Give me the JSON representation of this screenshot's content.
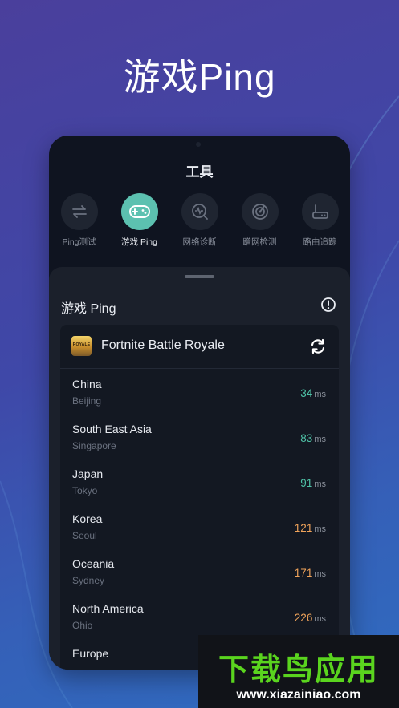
{
  "hero_title": "游戏Ping",
  "tools": {
    "title": "工具",
    "items": [
      {
        "label": "Ping测试",
        "icon": "arrows-swap-icon",
        "active": false
      },
      {
        "label": "游戏 Ping",
        "icon": "gamepad-icon",
        "active": true
      },
      {
        "label": "网络诊断",
        "icon": "network-diagnosis-icon",
        "active": false
      },
      {
        "label": "蹭网检测",
        "icon": "radar-icon",
        "active": false
      },
      {
        "label": "路由追踪",
        "icon": "router-icon",
        "active": false
      }
    ]
  },
  "panel": {
    "title": "游戏 Ping",
    "info_icon": "info-icon",
    "game": {
      "name": "Fortnite Battle Royale",
      "logo_text": "ROYALE",
      "refresh_icon": "refresh-icon"
    },
    "unit": "ms",
    "regions": [
      {
        "name": "China",
        "city": "Beijing",
        "ping": "34",
        "level": "good"
      },
      {
        "name": "South East Asia",
        "city": "Singapore",
        "ping": "83",
        "level": "good"
      },
      {
        "name": "Japan",
        "city": "Tokyo",
        "ping": "91",
        "level": "good"
      },
      {
        "name": "Korea",
        "city": "Seoul",
        "ping": "121",
        "level": "warn"
      },
      {
        "name": "Oceania",
        "city": "Sydney",
        "ping": "171",
        "level": "warn"
      },
      {
        "name": "North America",
        "city": "Ohio",
        "ping": "226",
        "level": "warn"
      },
      {
        "name": "Europe",
        "city": "",
        "ping": "",
        "level": "warn"
      }
    ]
  },
  "colors": {
    "good": "#4fc3a8",
    "warn": "#f0a35a",
    "accent": "#5cc1b0"
  },
  "watermark": {
    "main": "下载鸟应用",
    "url": "www.xiazainiao.com"
  }
}
